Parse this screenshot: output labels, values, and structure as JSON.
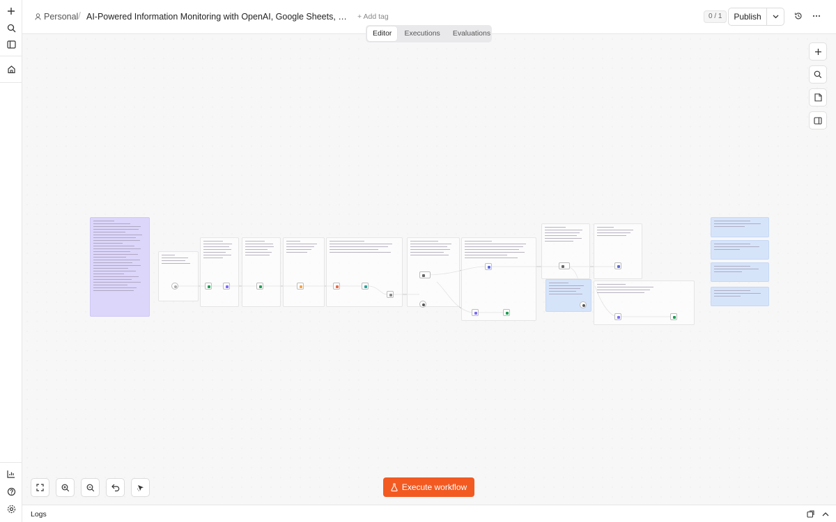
{
  "header": {
    "breadcrumb_project": "Personal",
    "breadcrumb_separator": "/",
    "workflow_title": "AI-Powered Information Monitoring with OpenAI, Google Sheets, Jina AI a...",
    "add_tag": "+ Add tag",
    "version_badge": "0 / 1",
    "publish_label": "Publish"
  },
  "tabs": [
    {
      "label": "Editor",
      "active": true
    },
    {
      "label": "Executions",
      "active": false
    },
    {
      "label": "Evaluations",
      "active": false
    }
  ],
  "canvas": {
    "execute_label": "Execute workflow"
  },
  "logs": {
    "label": "Logs"
  },
  "icons": {
    "rail": [
      "plus-icon",
      "search-icon",
      "sidebar-toggle-icon",
      "home-icon",
      "insights-icon",
      "help-icon",
      "settings-icon"
    ],
    "canvas_right": [
      "add-node-icon",
      "search-nodes-icon",
      "sticky-note-icon",
      "panel-toggle-icon"
    ],
    "canvas_bottom": [
      "fit-view-icon",
      "zoom-in-icon",
      "zoom-out-icon",
      "undo-icon",
      "cursor-tidy-icon"
    ]
  },
  "colors": {
    "accent": "#f25a22",
    "sticky_purple": "#dcd6fb",
    "sticky_blue": "#d6e4fa"
  }
}
